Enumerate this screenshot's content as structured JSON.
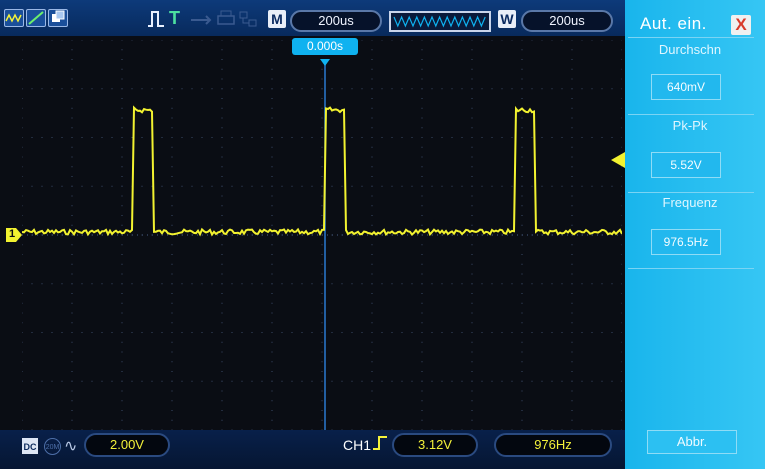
{
  "top_bar": {
    "trigger_mode_label": "T",
    "horizontal_box_label": "M",
    "timebase": "200us",
    "window_box_label": "W",
    "window_timebase": "200us"
  },
  "trigger_position": "0.000s",
  "right_panel": {
    "title": "Aut. ein.",
    "close_label": "X",
    "measurements": [
      {
        "label": "Durchschn",
        "value": "640mV"
      },
      {
        "label": "Pk-Pk",
        "value": "5.52V"
      },
      {
        "label": "Frequenz",
        "value": "976.5Hz"
      }
    ],
    "abbr_button": "Abbr."
  },
  "bottom_bar": {
    "coupling_label": "DC",
    "bw_label": "20M",
    "vertical_scale": "2.00V",
    "channel_label": "CH1",
    "trigger_level": "3.12V",
    "frequency": "976Hz"
  },
  "channel_marker_label": "1",
  "colors": {
    "trace": "#f2f230",
    "panel": "#22bdf0",
    "bar": "#0b2f6a",
    "grid_dot": "#3a4a68"
  }
}
